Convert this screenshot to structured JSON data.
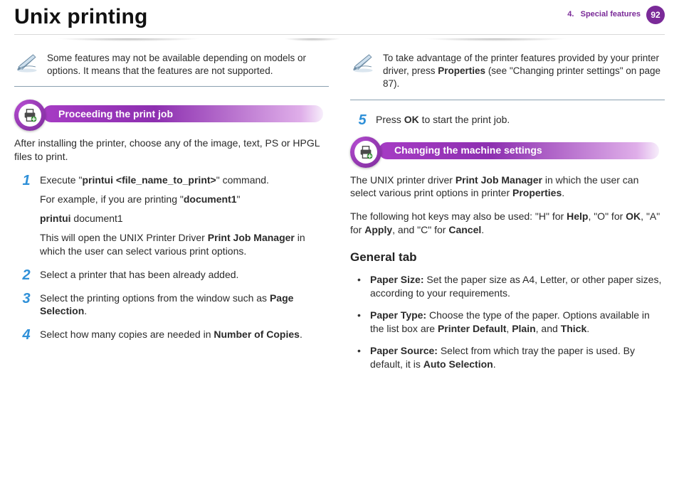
{
  "header": {
    "title": "Unix printing",
    "chapter_prefix": "4.",
    "chapter_name": "Special features",
    "page_number": "92"
  },
  "left": {
    "note": "Some features may not be available depending on models or options. It means that the features are not supported.",
    "section_title": "Proceeding the print job",
    "intro": "After installing the printer, choose any of the image, text, PS or HPGL files to print.",
    "steps": {
      "s1": {
        "num": "1",
        "line1_pre": "Execute \"",
        "line1_cmd": "printui <file_name_to_print>",
        "line1_post": "\" command.",
        "line2_pre": "For example, if you are printing \"",
        "line2_b": "document1",
        "line2_post": "\"",
        "line3_b": "printui",
        "line3_rest": " document1",
        "line4_pre": "This will open the UNIX Printer Driver ",
        "line4_b": "Print Job Manager",
        "line4_post": " in which the user can select various print options."
      },
      "s2": {
        "num": "2",
        "text": "Select a printer that has been already added."
      },
      "s3": {
        "num": "3",
        "pre": "Select the printing options from the window such as ",
        "b": "Page Selection",
        "post": "."
      },
      "s4": {
        "num": "4",
        "pre": "Select how many copies are needed in ",
        "b": "Number of Copies",
        "post": "."
      }
    }
  },
  "right": {
    "note_pre": "To take advantage of the printer features provided by your printer driver, press ",
    "note_b": "Properties",
    "note_post": " (see \"Changing printer settings\" on page 87).",
    "step5": {
      "num": "5",
      "pre": "Press ",
      "b": "OK",
      "post": " to start the print job."
    },
    "section_title": "Changing the machine settings",
    "p1_pre": "The UNIX printer driver ",
    "p1_b1": "Print Job Manager",
    "p1_mid": " in which the user can select various print options in printer ",
    "p1_b2": "Properties",
    "p1_post": ".",
    "p2_pre": "The following hot keys may also be used: \"H\" for ",
    "p2_b1": "Help",
    "p2_mid1": ", \"O\" for ",
    "p2_b2": "OK",
    "p2_mid2": ", \"A\" for ",
    "p2_b3": "Apply",
    "p2_mid3": ", and \"C\" for ",
    "p2_b4": "Cancel",
    "p2_post": ".",
    "h3": "General tab",
    "bullets": {
      "b1_label": "Paper Size:",
      "b1_text": " Set the paper size as A4, Letter, or other paper sizes, according to your requirements.",
      "b2_label": "Paper Type:",
      "b2_pre": " Choose the type of the paper. Options available in the list box are ",
      "b2_b1": "Printer Default",
      "b2_c1": ", ",
      "b2_b2": "Plain",
      "b2_c2": ", and ",
      "b2_b3": "Thick",
      "b2_post": ".",
      "b3_label": "Paper Source:",
      "b3_pre": " Select from which tray the paper is used. By default, it is ",
      "b3_b1": "Auto Selection",
      "b3_post": "."
    }
  }
}
